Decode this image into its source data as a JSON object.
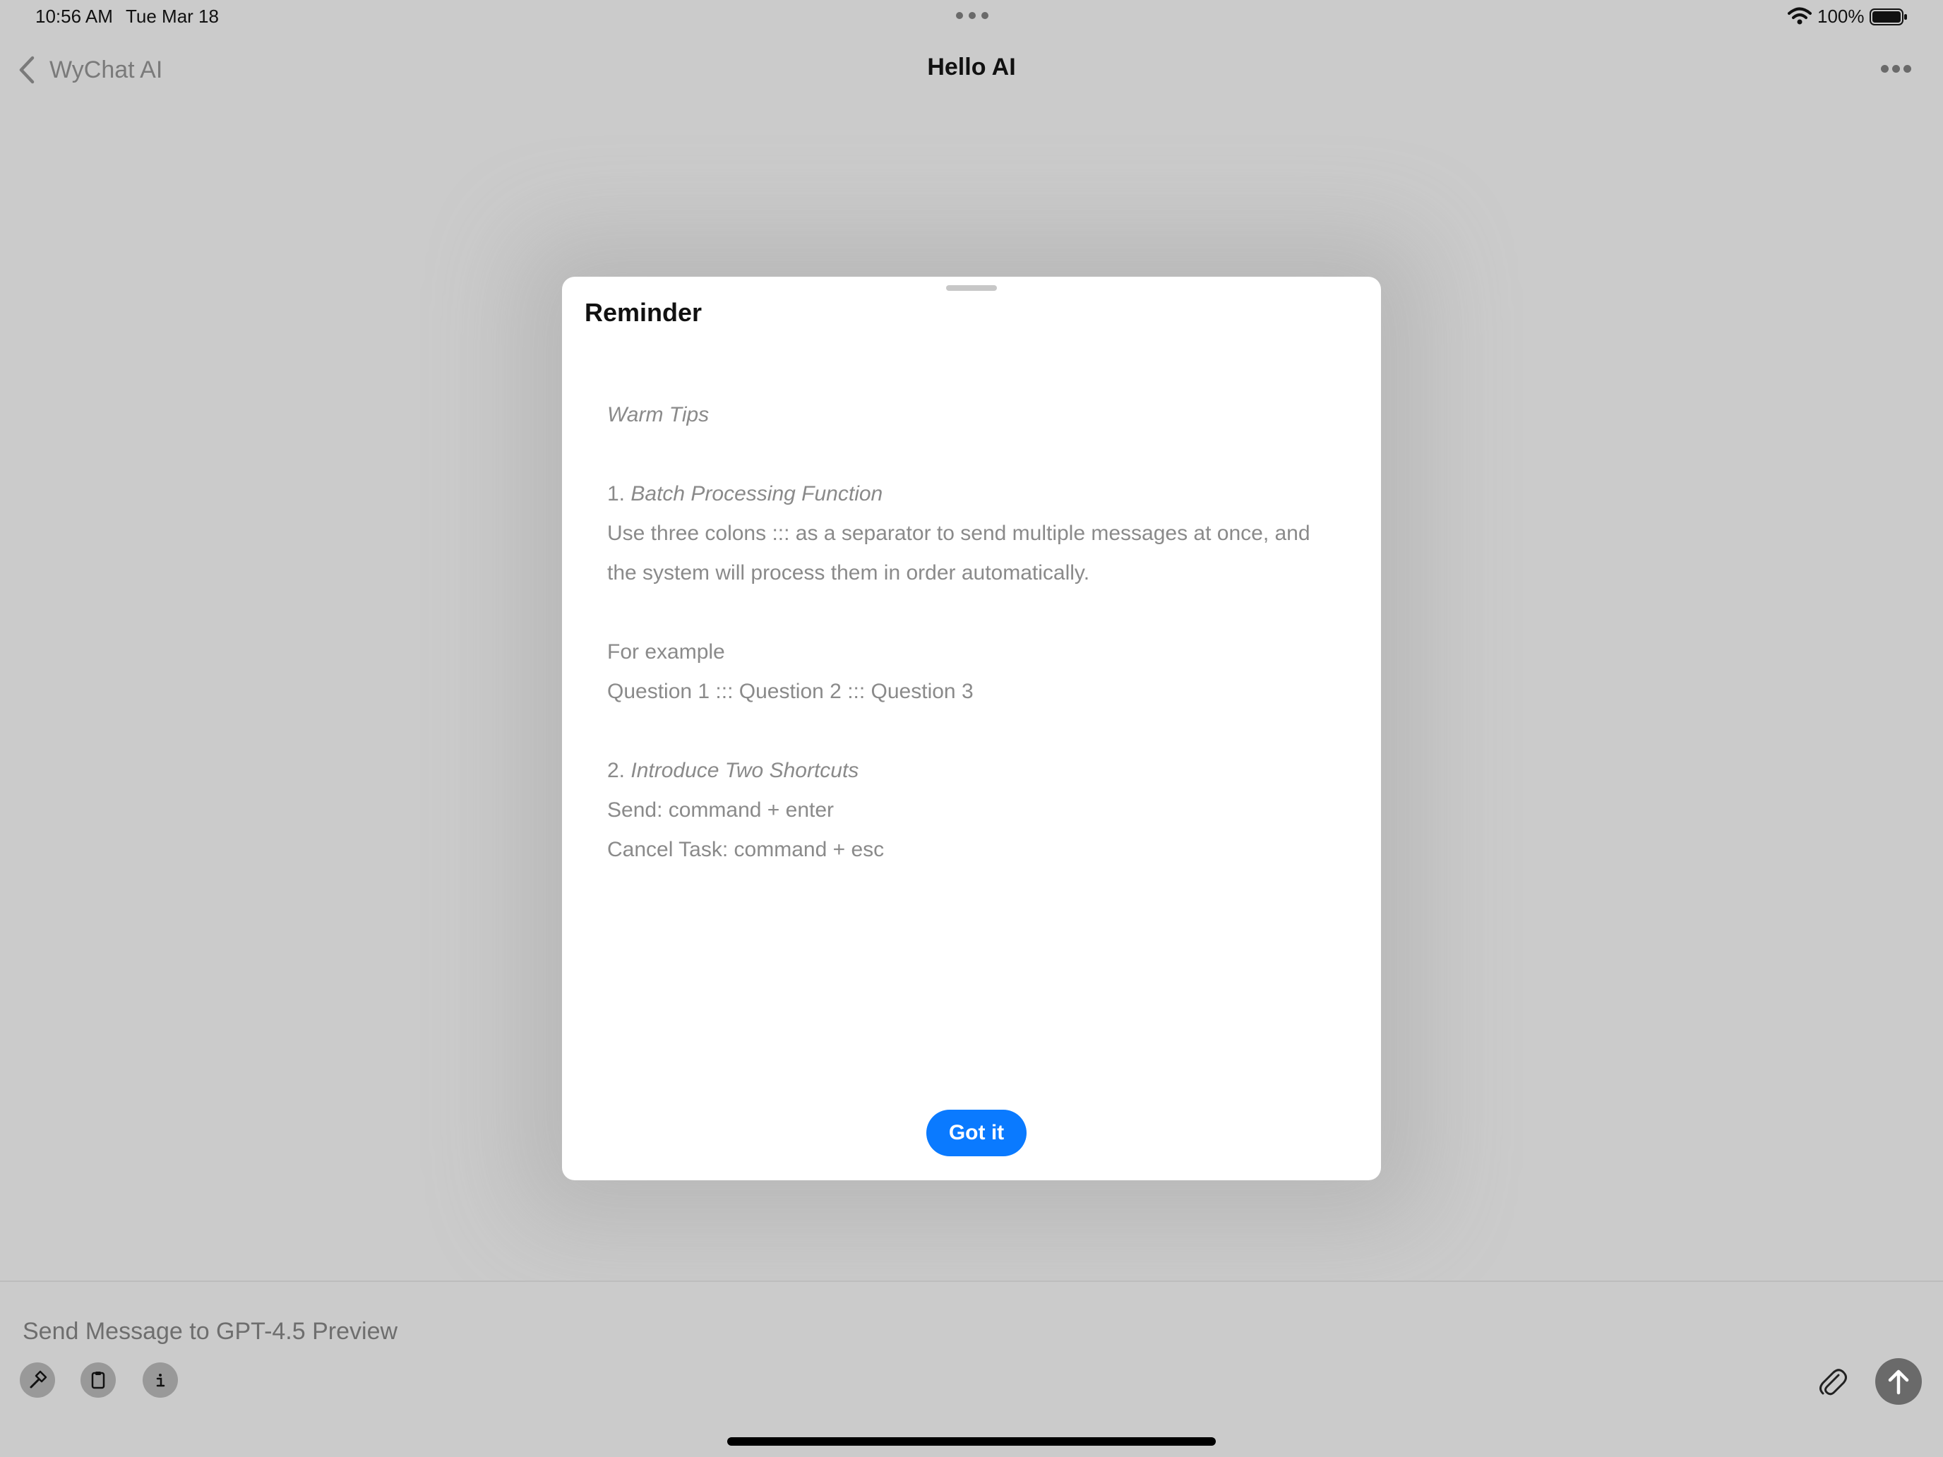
{
  "status_bar": {
    "time": "10:56 AM",
    "date": "Tue Mar 18",
    "battery": "100%",
    "icons": [
      "wifi-icon",
      "battery-icon"
    ]
  },
  "nav": {
    "back_label": "WyChat AI",
    "title": "Hello AI",
    "icons": [
      "chevron-left-icon",
      "more-icon"
    ]
  },
  "modal": {
    "title": "Reminder",
    "warm_tips": "Warm Tips",
    "section1_num": "1.",
    "section1_title": "Batch Processing Function",
    "section1_line1": "Use three colons ::: as a separator to send multiple messages at once, and",
    "section1_line2": "the system will process them in order automatically.",
    "example_label": "For example",
    "example_text": "Question 1 ::: Question 2 ::: Question 3",
    "section2_num": "2.",
    "section2_title": "Introduce Two Shortcuts",
    "shortcut_send": "Send: command + enter",
    "shortcut_cancel": "Cancel Task: command + esc",
    "button_label": "Got it",
    "button_color": "#0a7aff"
  },
  "composer": {
    "placeholder": "Send Message to GPT-4.5 Preview",
    "tool_icons": [
      "hammer-icon",
      "clipboard-icon",
      "info-icon"
    ],
    "right_icons": [
      "paperclip-icon",
      "arrow-up-icon"
    ]
  }
}
